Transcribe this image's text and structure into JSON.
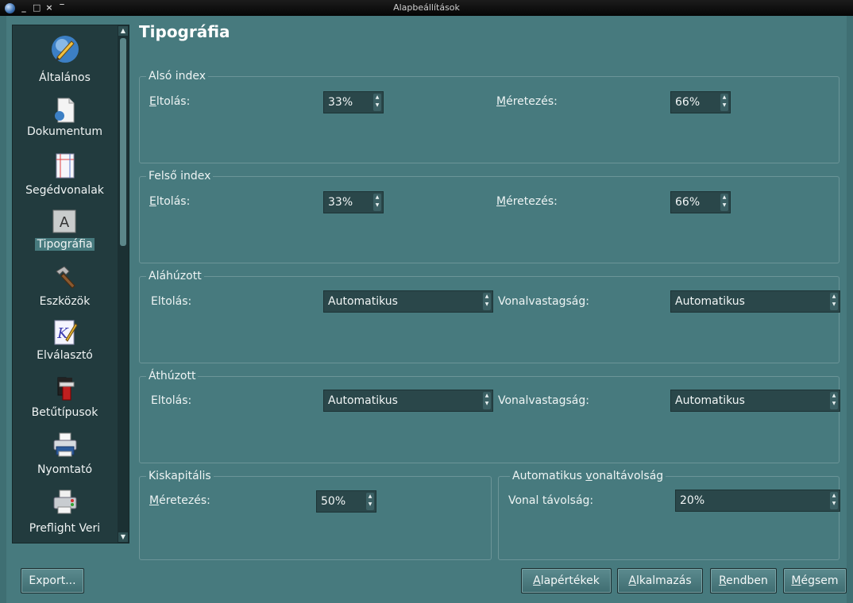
{
  "window": {
    "title": "Alapbeállítások",
    "controls": [
      "_",
      "□",
      "×",
      "‾"
    ]
  },
  "sidebar": {
    "items": [
      {
        "label": "Általános",
        "icon": "globe-pen-icon"
      },
      {
        "label": "Dokumentum",
        "icon": "document-icon"
      },
      {
        "label": "Segédvonalak",
        "icon": "guides-icon"
      },
      {
        "label": "Tipográfia",
        "icon": "typography-icon",
        "selected": true
      },
      {
        "label": "Eszközök",
        "icon": "hammer-icon"
      },
      {
        "label": "Elválasztó",
        "icon": "hyphenator-icon"
      },
      {
        "label": "Betűtípusok",
        "icon": "fonts-icon"
      },
      {
        "label": "Nyomtató",
        "icon": "printer-icon"
      },
      {
        "label": "Preflight Veri",
        "icon": "preflight-icon"
      }
    ]
  },
  "page": {
    "title": "Tipográfia",
    "subscript": {
      "title": "Alsó index",
      "offset_label": "Eltolás:",
      "offset_value": "33%",
      "scale_label": "Méretezés:",
      "scale_value": "66%"
    },
    "superscript": {
      "title": "Felső index",
      "offset_label": "Eltolás:",
      "offset_value": "33%",
      "scale_label": "Méretezés:",
      "scale_value": "66%"
    },
    "underline": {
      "title": "Aláhúzott",
      "offset_label": "Eltolás:",
      "offset_value": "Automatikus",
      "width_label": "Vonalvastagság:",
      "width_value": "Automatikus"
    },
    "strikethrough": {
      "title": "Áthúzott",
      "offset_label": "Eltolás:",
      "offset_value": "Automatikus",
      "width_label": "Vonalvastagság:",
      "width_value": "Automatikus"
    },
    "smallcaps": {
      "title": "Kiskapitális",
      "scale_label": "Méretezés:",
      "scale_value": "50%"
    },
    "autospacing": {
      "title": "Automatikus vonaltávolság",
      "distance_label": "Vonal távolság:",
      "distance_value": "20%"
    }
  },
  "buttons": {
    "export": "Export...",
    "defaults": "Alapértékek",
    "apply": "Alkalmazás",
    "ok": "Rendben",
    "cancel": "Mégsem"
  },
  "colors": {
    "window_bg": "#477a7e",
    "sidebar_bg": "#223b3e",
    "field_bg": "#2a474a"
  }
}
